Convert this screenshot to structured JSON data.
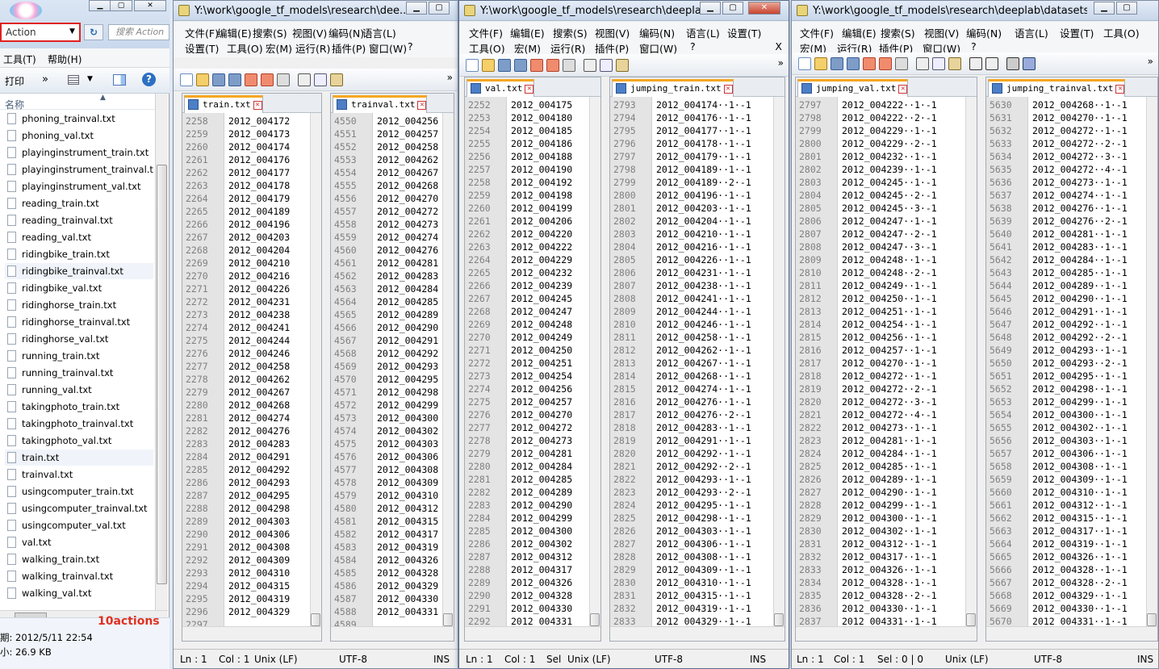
{
  "explorer": {
    "search_placeholder": "Action",
    "search_hint": "搜索 Action",
    "menu": [
      "工具(T)",
      "帮助(H)"
    ],
    "toolbar": {
      "print": "打印",
      "more": "»"
    },
    "column_header": "名称",
    "files": [
      "phoning_trainval.txt",
      "phoning_val.txt",
      "playinginstrument_train.txt",
      "playinginstrument_trainval.txt",
      "playinginstrument_val.txt",
      "reading_train.txt",
      "reading_trainval.txt",
      "reading_val.txt",
      "ridingbike_train.txt",
      "ridingbike_trainval.txt",
      "ridingbike_val.txt",
      "ridinghorse_train.txt",
      "ridinghorse_trainval.txt",
      "ridinghorse_val.txt",
      "running_train.txt",
      "running_trainval.txt",
      "running_val.txt",
      "takingphoto_train.txt",
      "takingphoto_trainval.txt",
      "takingphoto_val.txt",
      "train.txt",
      "trainval.txt",
      "usingcomputer_train.txt",
      "usingcomputer_trainval.txt",
      "usingcomputer_val.txt",
      "val.txt",
      "walking_train.txt",
      "walking_trainval.txt",
      "walking_val.txt"
    ],
    "status": {
      "date": "期: 2012/5/11 22:54",
      "size": "小: 26.9 KB"
    },
    "annotation": "10actions"
  },
  "windows": [
    {
      "title": "Y:\\work\\google_tf_models\\research\\dee...",
      "menu_row1": [
        "文件(F)",
        "编辑(E)",
        "搜索(S)",
        "视图(V)",
        "编码(N)",
        "语言(L)"
      ],
      "menu_row2": [
        "设置(T)",
        "工具(O)",
        "宏(M)",
        "运行(R)",
        "插件(P)",
        "窗口(W)",
        "?"
      ],
      "panes": [
        {
          "tab": "train.txt",
          "start": 2258,
          "lines": [
            "2012_004172",
            "2012_004173",
            "2012_004174",
            "2012_004176",
            "2012_004177",
            "2012_004178",
            "2012_004179",
            "2012_004189",
            "2012_004196",
            "2012_004203",
            "2012_004204",
            "2012_004210",
            "2012_004216",
            "2012_004226",
            "2012_004231",
            "2012_004238",
            "2012_004241",
            "2012_004244",
            "2012_004246",
            "2012_004258",
            "2012_004262",
            "2012_004267",
            "2012_004268",
            "2012_004274",
            "2012_004276",
            "2012_004283",
            "2012_004291",
            "2012_004292",
            "2012_004293",
            "2012_004295",
            "2012_004298",
            "2012_004303",
            "2012_004306",
            "2012_004308",
            "2012_004309",
            "2012_004310",
            "2012_004315",
            "2012_004319",
            "2012_004329",
            ""
          ]
        },
        {
          "tab": "trainval.txt",
          "start": 4550,
          "lines": [
            "2012_004256",
            "2012_004257",
            "2012_004258",
            "2012_004262",
            "2012_004267",
            "2012_004268",
            "2012_004270",
            "2012_004272",
            "2012_004273",
            "2012_004274",
            "2012_004276",
            "2012_004281",
            "2012_004283",
            "2012_004284",
            "2012_004285",
            "2012_004289",
            "2012_004290",
            "2012_004291",
            "2012_004292",
            "2012_004293",
            "2012_004295",
            "2012_004298",
            "2012_004299",
            "2012_004300",
            "2012_004302",
            "2012_004303",
            "2012_004306",
            "2012_004308",
            "2012_004309",
            "2012_004310",
            "2012_004312",
            "2012_004315",
            "2012_004317",
            "2012_004319",
            "2012_004326",
            "2012_004328",
            "2012_004329",
            "2012_004330",
            "2012_004331",
            ""
          ]
        }
      ],
      "status": {
        "ln": "Ln : 1",
        "col": "Col : 1",
        "eol": "Unix (LF)",
        "enc": "UTF-8",
        "ins": "INS"
      }
    },
    {
      "title": "Y:\\work\\google_tf_models\\research\\deeplab\\d...",
      "menu_row1": [
        "文件(F)",
        "编辑(E)",
        "搜索(S)",
        "视图(V)",
        "编码(N)",
        "语言(L)",
        "设置(T)"
      ],
      "menu_row2": [
        "工具(O)",
        "宏(M)",
        "运行(R)",
        "插件(P)",
        "窗口(W)",
        "?"
      ],
      "close_x": "X",
      "panes": [
        {
          "tab": "val.txt",
          "start": 2252,
          "lines": [
            "2012_004175",
            "2012_004180",
            "2012_004185",
            "2012_004186",
            "2012_004188",
            "2012_004190",
            "2012_004192",
            "2012_004198",
            "2012_004199",
            "2012_004206",
            "2012_004220",
            "2012_004222",
            "2012_004229",
            "2012_004232",
            "2012_004239",
            "2012_004245",
            "2012_004247",
            "2012_004248",
            "2012_004249",
            "2012_004250",
            "2012_004251",
            "2012_004254",
            "2012_004256",
            "2012_004257",
            "2012_004270",
            "2012_004272",
            "2012_004273",
            "2012_004281",
            "2012_004284",
            "2012_004285",
            "2012_004289",
            "2012_004290",
            "2012_004299",
            "2012_004300",
            "2012_004302",
            "2012_004312",
            "2012_004317",
            "2012_004326",
            "2012_004328",
            "2012_004330",
            "2012_004331",
            ""
          ]
        },
        {
          "tab": "jumping_train.txt",
          "start": 2793,
          "lines": [
            "2012_004174··1·-1",
            "2012_004176··1·-1",
            "2012_004177··1·-1",
            "2012_004178··1·-1",
            "2012_004179··1·-1",
            "2012_004189··1·-1",
            "2012_004189··2·-1",
            "2012_004196··1·-1",
            "2012_004203··1·-1",
            "2012_004204··1·-1",
            "2012_004210··1·-1",
            "2012_004216··1·-1",
            "2012_004226··1·-1",
            "2012_004231··1·-1",
            "2012_004238··1·-1",
            "2012_004241··1·-1",
            "2012_004244··1·-1",
            "2012_004246··1·-1",
            "2012_004258··1·-1",
            "2012_004262··1·-1",
            "2012_004267··1·-1",
            "2012_004268··1·-1",
            "2012_004274··1·-1",
            "2012_004276··1·-1",
            "2012_004276··2·-1",
            "2012_004283··1·-1",
            "2012_004291··1·-1",
            "2012_004292··1·-1",
            "2012_004292··2·-1",
            "2012_004293··1·-1",
            "2012_004293··2·-1",
            "2012_004295··1·-1",
            "2012_004298··1·-1",
            "2012_004303··1·-1",
            "2012_004306··1·-1",
            "2012_004308··1·-1",
            "2012_004309··1·-1",
            "2012_004310··1·-1",
            "2012_004315··1·-1",
            "2012_004319··1·-1",
            "2012_004329··1·-1",
            ""
          ]
        }
      ],
      "status": {
        "ln": "Ln : 1",
        "col": "Col : 1",
        "sel": "Sel",
        "eol": "Unix (LF)",
        "enc": "UTF-8",
        "ins": "INS"
      }
    },
    {
      "title": "Y:\\work\\google_tf_models\\research\\deeplab\\datasets\\pa...",
      "menu_row1": [
        "文件(F)",
        "编辑(E)",
        "搜索(S)",
        "视图(V)",
        "编码(N)",
        "语言(L)",
        "设置(T)",
        "工具(O)"
      ],
      "menu_row2": [
        "宏(M)",
        "运行(R)",
        "插件(P)",
        "窗口(W)",
        "?"
      ],
      "panes": [
        {
          "tab": "jumping_val.txt",
          "start": 2797,
          "lines": [
            "2012_004222··1·-1",
            "2012_004222··2·-1",
            "2012_004229··1·-1",
            "2012_004229··2·-1",
            "2012_004232··1·-1",
            "2012_004239··1·-1",
            "2012_004245··1·-1",
            "2012_004245··2·-1",
            "2012_004245··3·-1",
            "2012_004247··1·-1",
            "2012_004247··2·-1",
            "2012_004247··3·-1",
            "2012_004248··1·-1",
            "2012_004248··2·-1",
            "2012_004249··1·-1",
            "2012_004250··1·-1",
            "2012_004251··1·-1",
            "2012_004254··1·-1",
            "2012_004256··1·-1",
            "2012_004257··1·-1",
            "2012_004270··1·-1",
            "2012_004272··1·-1",
            "2012_004272··2·-1",
            "2012_004272··3·-1",
            "2012_004272··4·-1",
            "2012_004273··1·-1",
            "2012_004281··1·-1",
            "2012_004284··1·-1",
            "2012_004285··1·-1",
            "2012_004289··1·-1",
            "2012_004290··1·-1",
            "2012_004299··1·-1",
            "2012_004300··1·-1",
            "2012_004302··1·-1",
            "2012_004312··1·-1",
            "2012_004317··1·-1",
            "2012_004326··1·-1",
            "2012_004328··1·-1",
            "2012_004328··2·-1",
            "2012_004330··1·-1",
            "2012_004331··1·-1",
            ""
          ]
        },
        {
          "tab": "jumping_trainval.txt",
          "start": 5630,
          "lines": [
            "2012_004268··1·-1",
            "2012_004270··1·-1",
            "2012_004272··1·-1",
            "2012_004272··2·-1",
            "2012_004272··3·-1",
            "2012_004272··4·-1",
            "2012_004273··1·-1",
            "2012_004274··1·-1",
            "2012_004276··1·-1",
            "2012_004276··2·-1",
            "2012_004281··1·-1",
            "2012_004283··1·-1",
            "2012_004284··1·-1",
            "2012_004285··1·-1",
            "2012_004289··1·-1",
            "2012_004290··1·-1",
            "2012_004291··1·-1",
            "2012_004292··1·-1",
            "2012_004292··2·-1",
            "2012_004293··1·-1",
            "2012_004293··2·-1",
            "2012_004295··1·-1",
            "2012_004298··1·-1",
            "2012_004299··1·-1",
            "2012_004300··1·-1",
            "2012_004302··1·-1",
            "2012_004303··1·-1",
            "2012_004306··1·-1",
            "2012_004308··1·-1",
            "2012_004309··1·-1",
            "2012_004310··1·-1",
            "2012_004312··1·-1",
            "2012_004315··1·-1",
            "2012_004317··1·-1",
            "2012_004319··1·-1",
            "2012_004326··1·-1",
            "2012_004328··1·-1",
            "2012_004328··2·-1",
            "2012_004329··1·-1",
            "2012_004330··1·-1",
            "2012_004331··1·-1",
            ""
          ]
        }
      ],
      "status": {
        "ln": "Ln : 1",
        "col": "Col : 1",
        "sel": "Sel : 0 | 0",
        "eol": "Unix (LF)",
        "enc": "UTF-8",
        "ins": "INS"
      }
    }
  ]
}
